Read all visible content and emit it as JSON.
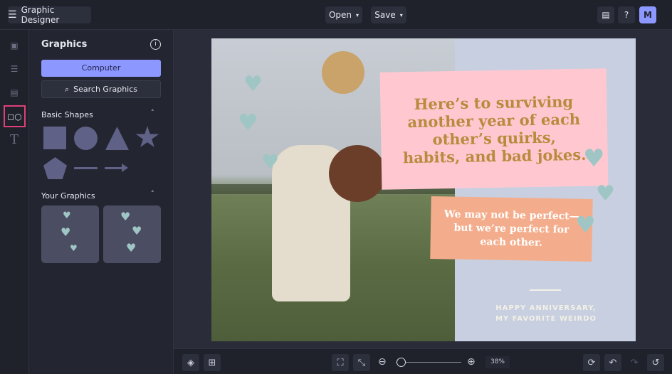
{
  "header": {
    "title": "Graphic Designer",
    "open_label": "Open",
    "save_label": "Save",
    "avatar_initial": "M"
  },
  "panel": {
    "title": "Graphics",
    "computer_label": "Computer",
    "search_label": "Search Graphics",
    "basic_shapes_label": "Basic Shapes",
    "your_graphics_label": "Your Graphics"
  },
  "card": {
    "headline": "Here’s to surviving another year of each other’s quirks, habits, and bad jokes.",
    "subtext": "We may not be perfect—but we’re perfect for each other.",
    "footer_line1": "HAPPY ANNIVERSARY,",
    "footer_line2": "MY FAVORITE WEIRDO"
  },
  "toolbar": {
    "zoom_value": "38%",
    "zoom_fraction": 0.04
  },
  "colors": {
    "accent": "#8c97ff",
    "selected_outline": "#e0407a",
    "pink_box": "#ffc8d0",
    "peach_box": "#f4ad8c",
    "headline_text": "#b98a3d",
    "heart": "#9fc6c4"
  }
}
